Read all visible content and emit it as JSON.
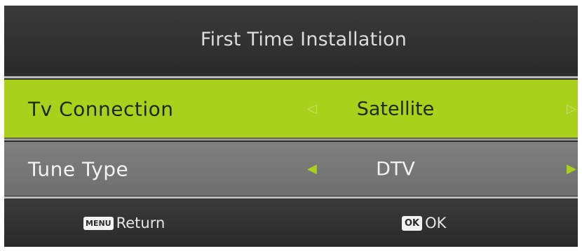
{
  "header": {
    "title": "First Time Installation"
  },
  "settings": [
    {
      "label": "Tv Connection",
      "value": "Satellite",
      "selected": true,
      "left_arrow": "◁",
      "right_arrow": "▷"
    },
    {
      "label": "Tune Type",
      "value": "DTV",
      "selected": false,
      "left_arrow": "◀",
      "right_arrow": "▶"
    }
  ],
  "footer": {
    "return_key": "MENU",
    "return_label": "Return",
    "ok_key": "OK",
    "ok_label": "OK"
  },
  "colors": {
    "highlight": "#a9d11b",
    "background": "#2f2f2f",
    "row": "#777777"
  }
}
